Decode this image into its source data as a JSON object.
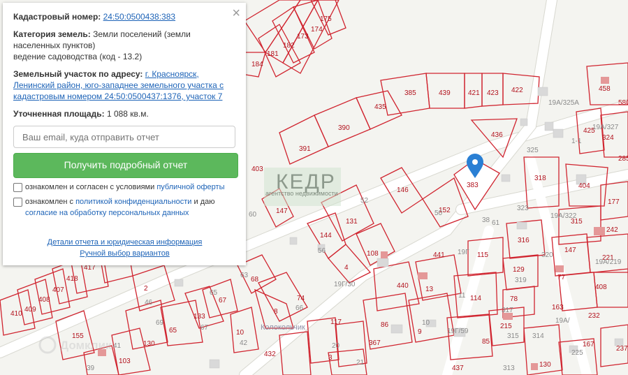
{
  "panel": {
    "cadastral_label": "Кадастровый номер:",
    "cadastral_number": "24:50:0500438:383",
    "category_label": "Категория земель:",
    "category_value": "Земли поселений (земли населенных пунктов)",
    "category_use": "ведение садоводства (код - 13.2)",
    "address_label": "Земельный участок по адресу:",
    "address_value": "г. Красноярск, Ленинский район, юго-западнее земельного участка с кадастровым номером 24:50:0500437:1376, участок 7",
    "area_label": "Уточненная площадь:",
    "area_value": "1 088 кв.м.",
    "email_placeholder": "Ваш email, куда отправить отчет",
    "submit_label": "Получить подробный отчет",
    "consent1_prefix": "ознакомлен и согласен с условиями ",
    "consent1_link": "публичной оферты",
    "consent2_prefix": "ознакомлен с ",
    "consent2_link": "политикой конфиденциальности",
    "consent2_mid": " и даю",
    "consent2_link2": "согласие на обработку персональных данных",
    "details_link": "Детали отчета и юридическая информация",
    "manual_link": "Ручной выбор вариантов",
    "close_symbol": "×"
  },
  "watermark": {
    "brand": "КЕДР",
    "tagline": "агентство недвижимости"
  },
  "map": {
    "selected_plot": "383",
    "street_name": "Колокольчик",
    "corner_watermark": "Домклик",
    "colors": {
      "plot_border": "#d0242f",
      "marker": "#2a7fd4",
      "button": "#5cb85c",
      "link": "#1d63b7"
    }
  }
}
